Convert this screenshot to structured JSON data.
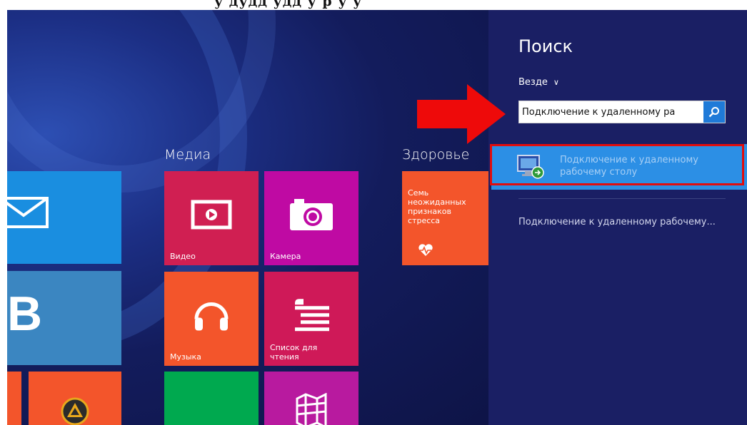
{
  "header_strip": {
    "text": "у дудд удд у р у у"
  },
  "charm": {
    "title": "Поиск",
    "scope_label": "Везде",
    "search_value": "Подключение к удаленному ра",
    "top_result": "Подключение к удаленному рабочему столу",
    "second_result": "Подключение к удаленному рабочему..."
  },
  "groups": {
    "media": "Медиа",
    "health": "Здоровье"
  },
  "tiles": {
    "video": "Видео",
    "camera": "Камера",
    "music": "Музыка",
    "reading_list": "Список для чтения",
    "health_news": "Семь неожиданных признаков стресса"
  },
  "colors": {
    "charm_bg": "#1a1f64",
    "result_highlight": "#2c8fe5",
    "annotation_red": "#e20d0d",
    "tile_video": "#d01f52",
    "tile_camera": "#bf0aa3",
    "tile_music": "#f3552b",
    "tile_reading": "#cf1958",
    "tile_health": "#f3552b",
    "tile_mail": "#1a8ee0",
    "tile_vk": "#3b86c1",
    "tile_green": "#00a94f",
    "tile_maps": "#b81a9f"
  },
  "icons": [
    "mail-icon",
    "vk-icon",
    "aimp-icon",
    "video-icon",
    "camera-icon",
    "headphones-icon",
    "reading-list-icon",
    "maps-icon",
    "heart-rate-icon",
    "search-icon",
    "remote-desktop-icon",
    "chevron-down-icon",
    "red-arrow"
  ]
}
